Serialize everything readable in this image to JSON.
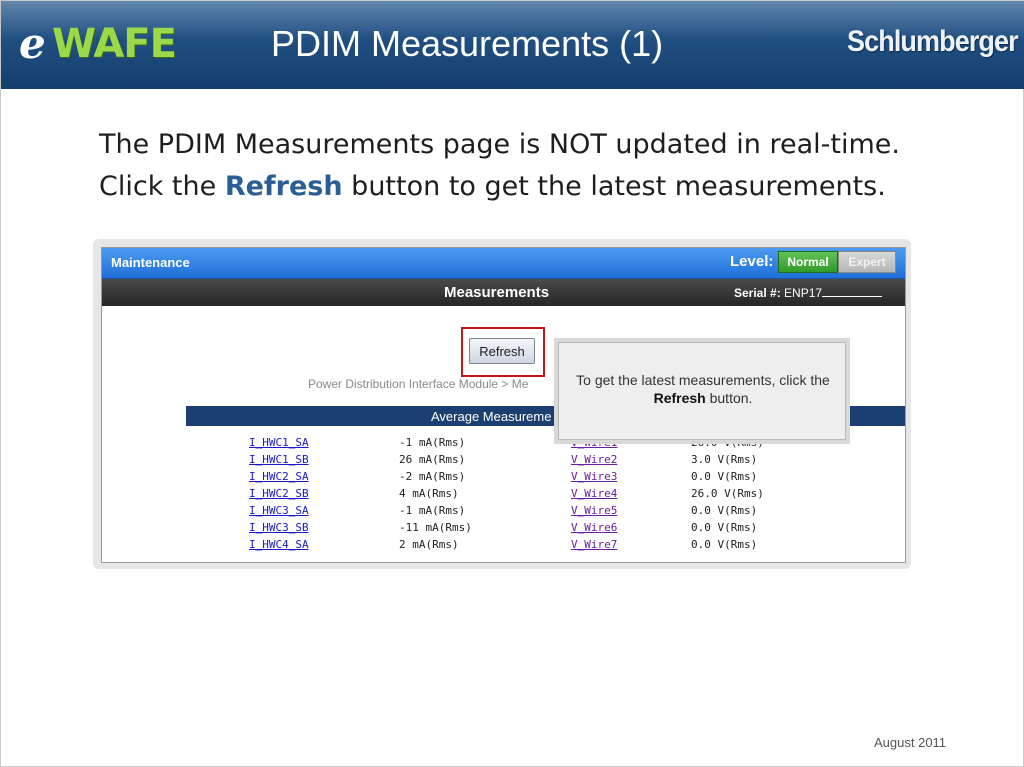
{
  "header": {
    "logo_prefix": "e",
    "logo_text": "WAFE",
    "title": "PDIM Measurements (1)",
    "brand": "Schlumberger"
  },
  "body": {
    "line1": "The PDIM Measurements page is NOT updated in real-time.",
    "line2_pre": "Click the ",
    "line2_strong": "Refresh",
    "line2_post": " button to get the latest measurements."
  },
  "screenshot": {
    "menu_title": "Maintenance",
    "level_label": "Level:",
    "level_options": [
      "Normal",
      "Expert"
    ],
    "level_selected": "Normal",
    "page_title": "Measurements",
    "serial_label": "Serial #:",
    "serial_value": "ENP17",
    "refresh_label": "Refresh",
    "breadcrumb": "Power Distribution Interface Module > Me",
    "section_title": "Average Measureme",
    "tooltip": {
      "pre": "To get the latest measurements, click the ",
      "strong": "Refresh",
      "post": " button."
    },
    "rows": [
      {
        "current_name": "I_HWC1_SA",
        "current_value": "-1 mA(Rms)",
        "voltage_name": "V_Wire1",
        "voltage_value": "26.0 V(Rms)"
      },
      {
        "current_name": "I_HWC1_SB",
        "current_value": "26 mA(Rms)",
        "voltage_name": "V_Wire2",
        "voltage_value": "3.0 V(Rms)"
      },
      {
        "current_name": "I_HWC2_SA",
        "current_value": "-2 mA(Rms)",
        "voltage_name": "V_Wire3",
        "voltage_value": "0.0 V(Rms)"
      },
      {
        "current_name": "I_HWC2_SB",
        "current_value": "4 mA(Rms)",
        "voltage_name": "V_Wire4",
        "voltage_value": "26.0 V(Rms)"
      },
      {
        "current_name": "I_HWC3_SA",
        "current_value": "-1 mA(Rms)",
        "voltage_name": "V_Wire5",
        "voltage_value": "0.0 V(Rms)"
      },
      {
        "current_name": "I_HWC3_SB",
        "current_value": "-11 mA(Rms)",
        "voltage_name": "V_Wire6",
        "voltage_value": "0.0 V(Rms)"
      },
      {
        "current_name": "I_HWC4_SA",
        "current_value": "2 mA(Rms)",
        "voltage_name": "V_Wire7",
        "voltage_value": "0.0 V(Rms)"
      }
    ]
  },
  "footer": {
    "date": "August 2011"
  },
  "colors": {
    "header_blue": "#1f4e80",
    "logo_green": "#9bd84a",
    "refresh_emphasis": "#2c5e96",
    "highlight_red": "#c01818",
    "normal_green": "#2f9a2a"
  }
}
